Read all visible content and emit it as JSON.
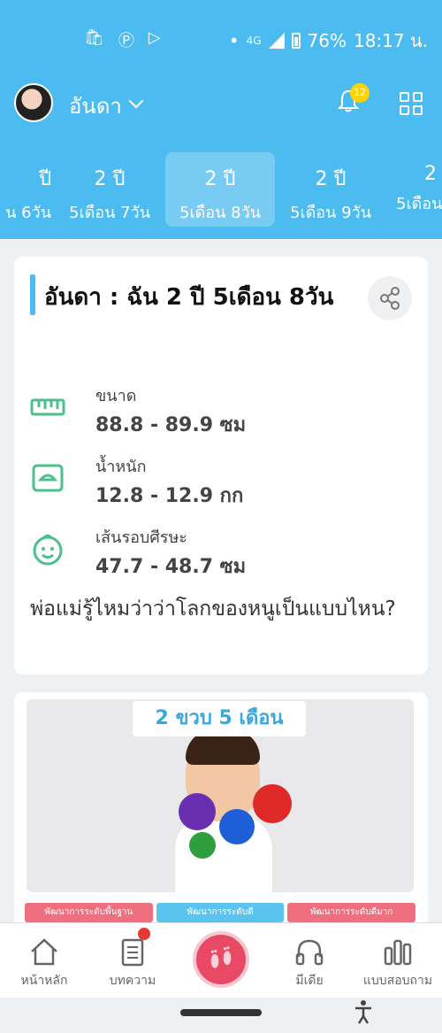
{
  "status_bar": {
    "network": "4G",
    "battery": "76%",
    "time": "18:17 น."
  },
  "app_bar": {
    "profile_name": "อันดา",
    "notification_count": "12"
  },
  "age_tabs": [
    {
      "years": "ปี",
      "months": "น 6วัน"
    },
    {
      "years": "2 ปี",
      "months": "5เดือน 7วัน"
    },
    {
      "years": "2 ปี",
      "months": "5เดือน 8วัน",
      "active": true
    },
    {
      "years": "2 ปี",
      "months": "5เดือน 9วัน"
    },
    {
      "years": "2",
      "months": "5เดือน"
    }
  ],
  "info_card": {
    "title": "อันดา : ฉัน 2 ปี 5เดือน 8วัน",
    "stats": [
      {
        "label": "ขนาด",
        "value": "88.8 - 89.9 ซม",
        "icon": "ruler-icon"
      },
      {
        "label": "น้ำหนัก",
        "value": "12.8 - 12.9 กก",
        "icon": "scale-icon"
      },
      {
        "label": "เส้นรอบศีรษะ",
        "value": "47.7 - 48.7 ซม",
        "icon": "baby-face-icon"
      }
    ],
    "question": "พ่อแม่รู้ไหมว่าว่าโลกของหนูเป็นแบบไหน?"
  },
  "image_card": {
    "label": "2 ขวบ 5 เดือน",
    "tags": [
      "พัฒนาการระดับพื้นฐาน",
      "พัฒนาการระดับดี",
      "พัฒนาการระดับดีมาก"
    ]
  },
  "bottom_nav": [
    {
      "label": "หน้าหลัก",
      "icon": "home-icon"
    },
    {
      "label": "บทความ",
      "icon": "article-icon"
    },
    {
      "label": "",
      "icon": "footprints-icon"
    },
    {
      "label": "มีเดีย",
      "icon": "headphones-icon"
    },
    {
      "label": "แบบสอบถาม",
      "icon": "bar-chart-icon"
    }
  ],
  "colors": {
    "primary": "#4bbbf0",
    "stat_icon": "#4bbf8c",
    "center_button": "#e84a66",
    "badge": "#ffd400"
  }
}
